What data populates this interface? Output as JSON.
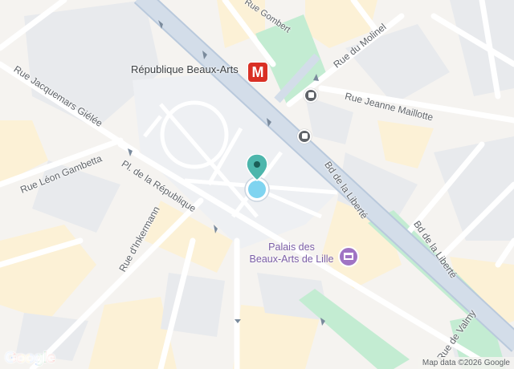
{
  "map": {
    "metro_station": {
      "name": "République Beaux-Arts",
      "icon_letter": "M",
      "icon": "metro-icon"
    },
    "poi": {
      "name_line1": "Palais des",
      "name_line2": "Beaux-Arts de Lille",
      "icon": "museum-icon"
    },
    "streets": {
      "rue_gombert": "Rue Gombert",
      "rue_du_molinel": "Rue du Molinel",
      "rue_jeanne_maillotte": "Rue Jeanne Maillotte",
      "rue_jacquemars_gielee": "Rue Jacquemars Giélée",
      "rue_leon_gambetta": "Rue Léon Gambetta",
      "pl_de_la_republique": "Pl. de la République",
      "rue_dinkermann": "Rue d'Inkermann",
      "bd_de_la_liberte_1": "Bd de la Liberté",
      "bd_de_la_liberte_2": "Bd de la Liberté",
      "rue_de_valmy": "Rue de Valmy"
    },
    "pin_icon": "location-pin-icon",
    "bus_icon": "bus-stop-icon"
  },
  "footer": {
    "logo": "Google",
    "attribution": "Map data ©2026 Google"
  },
  "colors": {
    "land": "#f5f3f0",
    "block": "#e8eaed",
    "yellow_block": "#fcf1d6",
    "park": "#c3ecd2",
    "road": "#ffffff",
    "main_road": "#b9c9dc",
    "metro_red": "#d93025",
    "pin_teal": "#4db6ac",
    "poi_purple": "#a074c4"
  }
}
